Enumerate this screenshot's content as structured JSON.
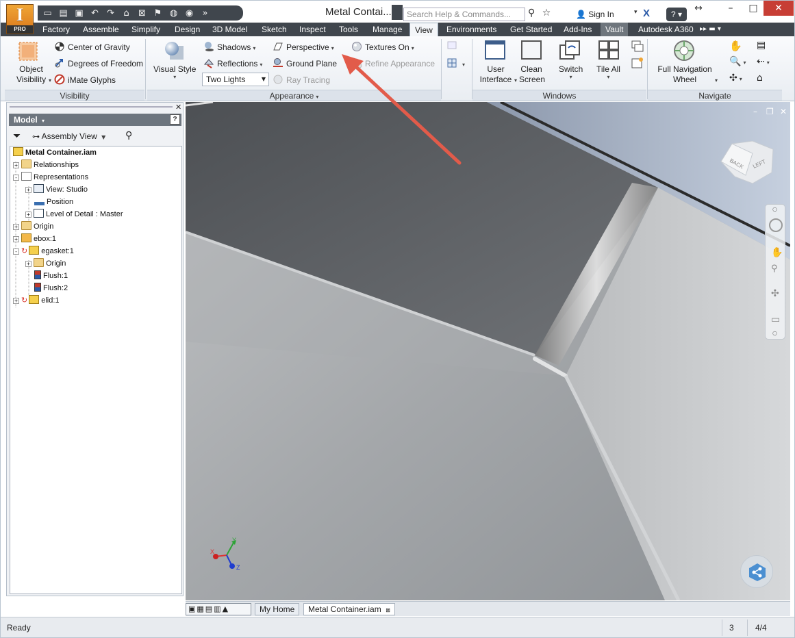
{
  "app": {
    "title": "Metal Contai...",
    "logo_edition": "PRO",
    "logo_letter": "I"
  },
  "search": {
    "placeholder": "Search Help & Commands..."
  },
  "account": {
    "sign_in": "Sign In"
  },
  "tabs": [
    "Factory",
    "Assemble",
    "Simplify",
    "Design",
    "3D Model",
    "Sketch",
    "Inspect",
    "Tools",
    "Manage",
    "View",
    "Environments",
    "Get Started",
    "Add-Ins",
    "Vault",
    "Autodesk A360"
  ],
  "active_tab": "View",
  "ribbon": {
    "visibility": {
      "label": "Visibility",
      "object_visibility": "Object Visibility",
      "center_of_gravity": "Center of Gravity",
      "degrees_of_freedom": "Degrees of Freedom",
      "imate_glyphs": "iMate Glyphs"
    },
    "appearance": {
      "label": "Appearance",
      "visual_style": "Visual Style",
      "shadows": "Shadows",
      "reflections": "Reflections",
      "lighting_value": "Two Lights",
      "perspective": "Perspective",
      "ground_plane": "Ground Plane",
      "ray_tracing": "Ray Tracing",
      "textures_on": "Textures On",
      "refine_appearance": "Refine Appearance"
    },
    "windows": {
      "label": "Windows",
      "user_interface": "User Interface",
      "clean_screen": "Clean Screen",
      "switch": "Switch",
      "tile_all": "Tile All"
    },
    "navigate": {
      "label": "Navigate",
      "full_nav_wheel": "Full Navigation Wheel"
    }
  },
  "browser": {
    "title": "Model",
    "view_mode": "Assembly View",
    "tree": [
      {
        "label": "Metal Container.iam",
        "level": 0,
        "bold": true,
        "icon": "assembly-icon"
      },
      {
        "label": "Relationships",
        "level": 1,
        "icon": "folder-icon",
        "exp": "+"
      },
      {
        "label": "Representations",
        "level": 1,
        "icon": "representations-icon",
        "exp": "-"
      },
      {
        "label": "View: Studio",
        "level": 2,
        "icon": "view-rep-icon",
        "exp": "+"
      },
      {
        "label": "Position",
        "level": 2,
        "icon": "position-icon"
      },
      {
        "label": "Level of Detail : Master",
        "level": 2,
        "icon": "lod-icon",
        "exp": "+"
      },
      {
        "label": "Origin",
        "level": 1,
        "icon": "folder-icon",
        "exp": "+"
      },
      {
        "label": "ebox:1",
        "level": 1,
        "icon": "part-icon",
        "exp": "+"
      },
      {
        "label": "egasket:1",
        "level": 1,
        "icon": "subassembly-icon",
        "exp": "-"
      },
      {
        "label": "Origin",
        "level": 2,
        "icon": "folder-icon",
        "exp": "+"
      },
      {
        "label": "Flush:1",
        "level": 2,
        "icon": "flush-constraint-icon"
      },
      {
        "label": "Flush:2",
        "level": 2,
        "icon": "flush-constraint-icon"
      },
      {
        "label": "elid:1",
        "level": 1,
        "icon": "subassembly-icon",
        "exp": "+"
      }
    ]
  },
  "viewcube": {
    "face_back": "BACK",
    "face_left": "LEFT"
  },
  "triad": {
    "x": "X",
    "y": "Y",
    "z": "Z"
  },
  "doc_tabs": [
    "My Home",
    "Metal Container.iam"
  ],
  "status": {
    "text": "Ready",
    "count": "3",
    "pages": "4/4"
  },
  "colors": {
    "tab_bar": "#40464d",
    "close_button": "#c73e35",
    "arrow": "#e25b4a",
    "accent_blue": "#2a5aa8"
  }
}
